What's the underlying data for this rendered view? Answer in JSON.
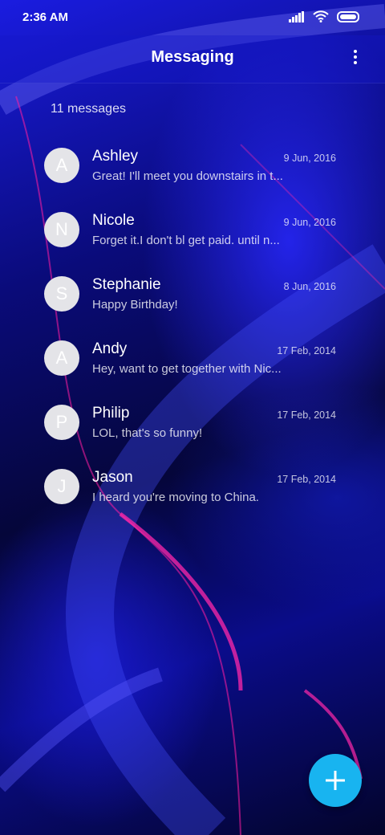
{
  "status_bar": {
    "time": "2:36 AM",
    "icons": [
      "signal-icon",
      "wifi-icon",
      "battery-icon"
    ]
  },
  "app_bar": {
    "title": "Messaging",
    "menu_icon": "overflow-menu-icon"
  },
  "message_count": "11 messages",
  "conversations": [
    {
      "initial": "A",
      "name": "Ashley",
      "date": "9 Jun, 2016",
      "preview": "Great! I'll meet you downstairs in t..."
    },
    {
      "initial": "N",
      "name": "Nicole",
      "date": "9 Jun, 2016",
      "preview": "Forget it.I don't bl get paid. until n..."
    },
    {
      "initial": "S",
      "name": "Stephanie",
      "date": "8 Jun, 2016",
      "preview": "Happy Birthday!"
    },
    {
      "initial": "A",
      "name": "Andy",
      "date": "17 Feb, 2014",
      "preview": "Hey, want to get together with Nic..."
    },
    {
      "initial": "P",
      "name": "Philip",
      "date": "17 Feb, 2014",
      "preview": "LOL, that's so funny!"
    },
    {
      "initial": "J",
      "name": "Jason",
      "date": "17 Feb, 2014",
      "preview": "I heard you're moving to China."
    }
  ],
  "fab": {
    "icon": "plus-icon"
  },
  "colors": {
    "fab": "#18b4f0",
    "avatar": "#e4e4e8",
    "wallpaper_accent": "#ff1a9c"
  }
}
